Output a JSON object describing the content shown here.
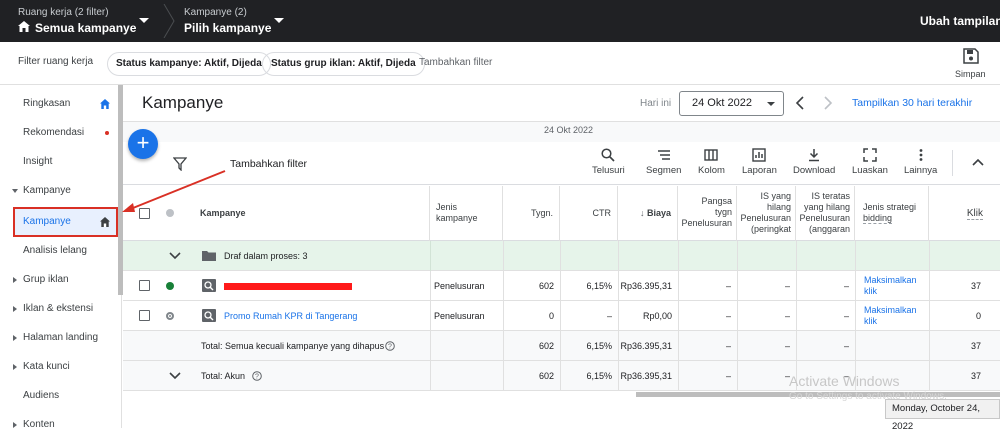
{
  "topbar": {
    "workspace_small": "Ruang kerja (2 filter)",
    "workspace_big": "Semua kampanye",
    "campaign_small": "Kampanye (2)",
    "campaign_big": "Pilih kampanye",
    "right_label": "Ubah tampilan"
  },
  "filterbar": {
    "label": "Filter ruang kerja",
    "chips": [
      "Status kampanye: Aktif, Dijeda",
      "Status grup iklan: Aktif, Dijeda"
    ],
    "add": "Tambahkan filter",
    "save": "Simpan"
  },
  "sidebar": {
    "items": [
      {
        "label": "Ringkasan"
      },
      {
        "label": "Rekomendasi"
      },
      {
        "label": "Insight"
      },
      {
        "label": "Kampanye"
      },
      {
        "label": "Kampanye"
      },
      {
        "label": "Analisis lelang"
      },
      {
        "label": "Grup iklan"
      },
      {
        "label": "Iklan & ekstensi"
      },
      {
        "label": "Halaman landing"
      },
      {
        "label": "Kata kunci"
      },
      {
        "label": "Audiens"
      },
      {
        "label": "Konten"
      }
    ]
  },
  "main": {
    "title": "Kampanye",
    "today_label": "Hari ini",
    "date_value": "24 Okt 2022",
    "show_30": "Tampilkan 30 hari terakhir",
    "subheader_date": "24 Okt 2022",
    "add_filter": "Tambahkan filter"
  },
  "toolbar": {
    "items": [
      "Telusuri",
      "Segmen",
      "Kolom",
      "Laporan",
      "Download",
      "Luaskan",
      "Lainnya"
    ]
  },
  "table": {
    "headers": {
      "campaign": "Kampanye",
      "type_1": "Jenis",
      "type_2": "kampanye",
      "impr": "Tygn.",
      "ctr": "CTR",
      "cost": "Biaya",
      "share_1": "Pangsa",
      "share_2": "tygn",
      "share_3": "Penelusuran",
      "lost_rank_1": "IS yang",
      "lost_rank_2": "hilang",
      "lost_rank_3": "Penelusuran",
      "lost_rank_4": "(peringkat",
      "lost_budget_1": "IS teratas",
      "lost_budget_2": "yang hilang",
      "lost_budget_3": "Penelusuran",
      "lost_budget_4": "(anggaran",
      "bidding_1": "Jenis strategi",
      "bidding_2": "bidding",
      "clicks": "Klik"
    },
    "draft_label": "Draf dalam proses: 3",
    "rows": [
      {
        "name": "",
        "type": "Penelusuran",
        "impr": "602",
        "ctr": "6,15%",
        "cost": "Rp36.395,31",
        "share": "–",
        "lost_rank": "–",
        "lost_budget": "–",
        "bid_1": "Maksimalkan",
        "bid_2": "klik",
        "clicks": "37"
      },
      {
        "name": "Promo Rumah KPR di Tangerang",
        "type": "Penelusuran",
        "impr": "0",
        "ctr": "–",
        "cost": "Rp0,00",
        "share": "–",
        "lost_rank": "–",
        "lost_budget": "–",
        "bid_1": "Maksimalkan",
        "bid_2": "klik",
        "clicks": "0"
      }
    ],
    "total_campaigns": {
      "label": "Total: Semua kecuali kampanye yang dihapus",
      "impr": "602",
      "ctr": "6,15%",
      "cost": "Rp36.395,31",
      "share": "–",
      "lost_rank": "–",
      "lost_budget": "–",
      "clicks": "37"
    },
    "total_account": {
      "label": "Total: Akun",
      "impr": "602",
      "ctr": "6,15%",
      "cost": "Rp36.395,31",
      "share": "–",
      "lost_rank": "–",
      "lost_budget": "–",
      "clicks": "37"
    }
  },
  "overlay": {
    "watermark_1": "Activate Windows",
    "watermark_2": "Go to Settings to activate Windows.",
    "tooltip": "Monday, October 24, 2022"
  },
  "colors": {
    "accent": "#1a73e8",
    "annotation": "#d93025",
    "green_dot": "#188038",
    "header_bg": "#202124"
  }
}
